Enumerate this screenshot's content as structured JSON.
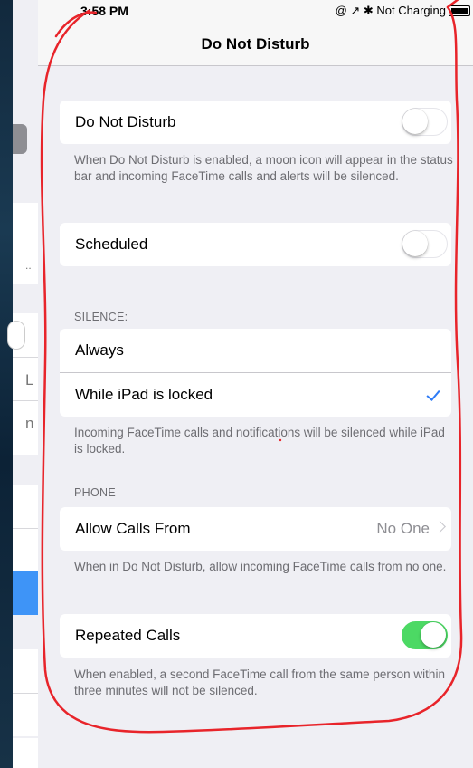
{
  "status_bar": {
    "time": "3:58 PM",
    "right_text": "@ ↗ ✱ Not Charging"
  },
  "navigation": {
    "title": "Do Not Disturb"
  },
  "master_pane": {
    "fragments": [
      "..",
      "L",
      "n"
    ]
  },
  "settings": {
    "do_not_disturb": {
      "label": "Do Not Disturb",
      "enabled": false,
      "footer": "When Do Not Disturb is enabled, a moon icon will appear in the status bar and incoming FaceTime calls and alerts will be silenced."
    },
    "scheduled": {
      "label": "Scheduled",
      "enabled": false
    },
    "silence": {
      "header": "SILENCE:",
      "options": [
        {
          "label": "Always",
          "selected": false
        },
        {
          "label": "While iPad is locked",
          "selected": true
        }
      ],
      "footer": "Incoming FaceTime calls and notifications will be silenced while iPad is locked."
    },
    "phone": {
      "header": "PHONE",
      "allow_calls_label": "Allow Calls From",
      "allow_calls_value": "No One",
      "footer": "When in Do Not Disturb, allow incoming FaceTime calls from no one."
    },
    "repeated_calls": {
      "label": "Repeated Calls",
      "enabled": true,
      "footer": "When enabled, a second FaceTime call from the same person within three minutes will not be silenced."
    }
  },
  "colors": {
    "accent_blue": "#2f7cf6",
    "toggle_on_green": "#4cd964",
    "annotation_red": "#e8242a",
    "grouped_background": "#efeff4"
  }
}
